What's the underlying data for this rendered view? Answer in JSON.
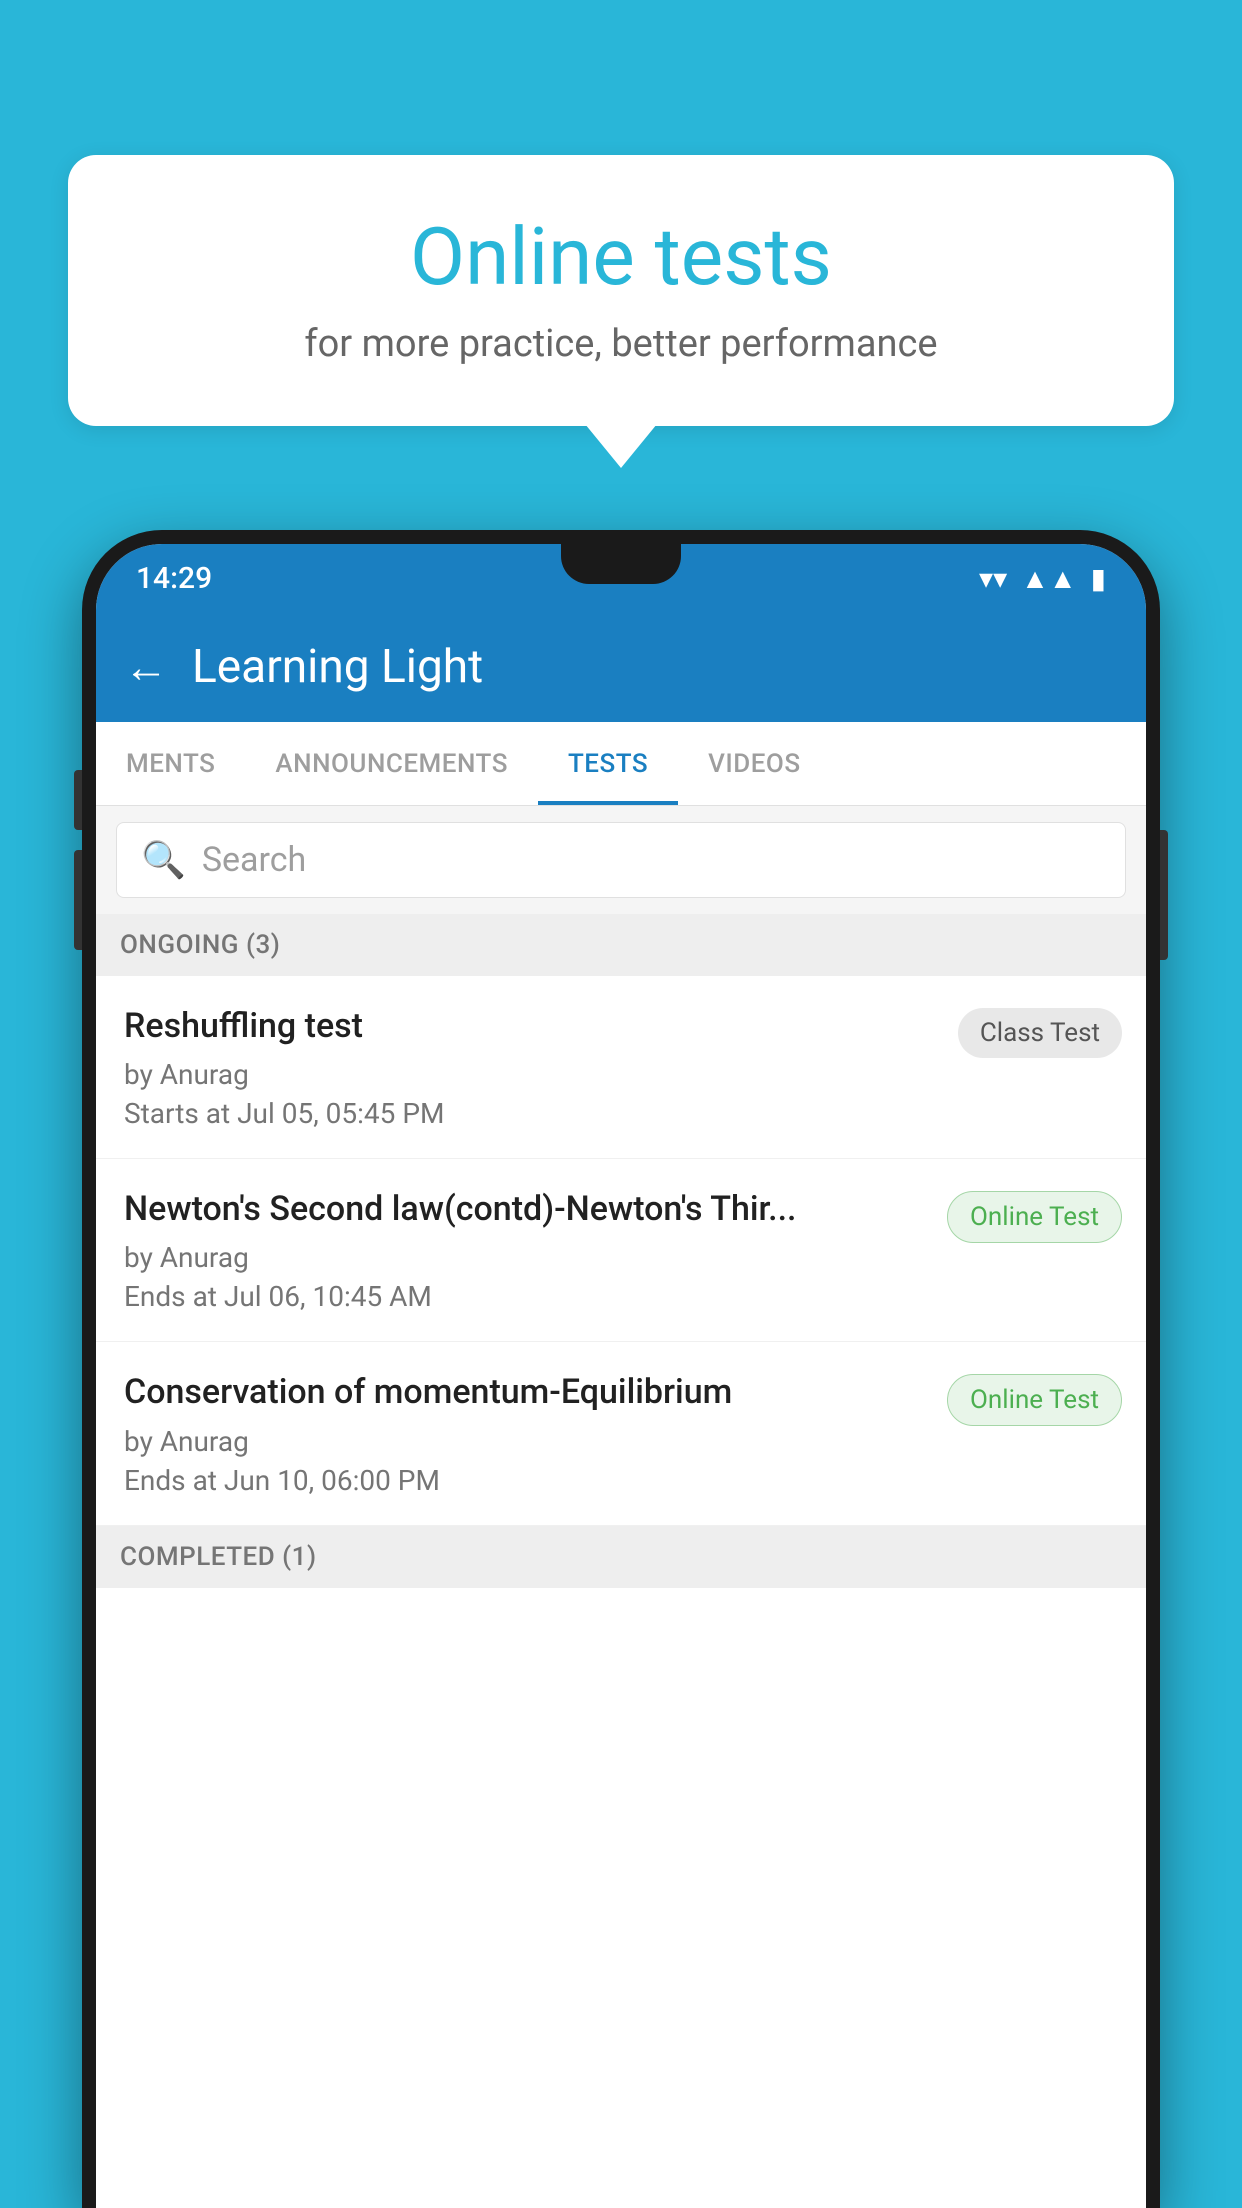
{
  "background_color": "#29b6d8",
  "bubble": {
    "title": "Online tests",
    "subtitle": "for more practice, better performance"
  },
  "phone": {
    "status_bar": {
      "time": "14:29",
      "wifi": "▾",
      "signal": "▴",
      "battery": "▮"
    },
    "app_bar": {
      "title": "Learning Light",
      "back_label": "←"
    },
    "tabs": [
      {
        "label": "MENTS",
        "active": false
      },
      {
        "label": "ANNOUNCEMENTS",
        "active": false
      },
      {
        "label": "TESTS",
        "active": true
      },
      {
        "label": "VIDEOS",
        "active": false
      }
    ],
    "search": {
      "placeholder": "Search"
    },
    "ongoing_section": {
      "header": "ONGOING (3)"
    },
    "tests": [
      {
        "title": "Reshuffling test",
        "author": "by Anurag",
        "date": "Starts at  Jul 05, 05:45 PM",
        "badge": "Class Test",
        "badge_type": "class"
      },
      {
        "title": "Newton's Second law(contd)-Newton's Thir...",
        "author": "by Anurag",
        "date": "Ends at  Jul 06, 10:45 AM",
        "badge": "Online Test",
        "badge_type": "online"
      },
      {
        "title": "Conservation of momentum-Equilibrium",
        "author": "by Anurag",
        "date": "Ends at  Jun 10, 06:00 PM",
        "badge": "Online Test",
        "badge_type": "online"
      }
    ],
    "completed_section": {
      "header": "COMPLETED (1)"
    }
  }
}
